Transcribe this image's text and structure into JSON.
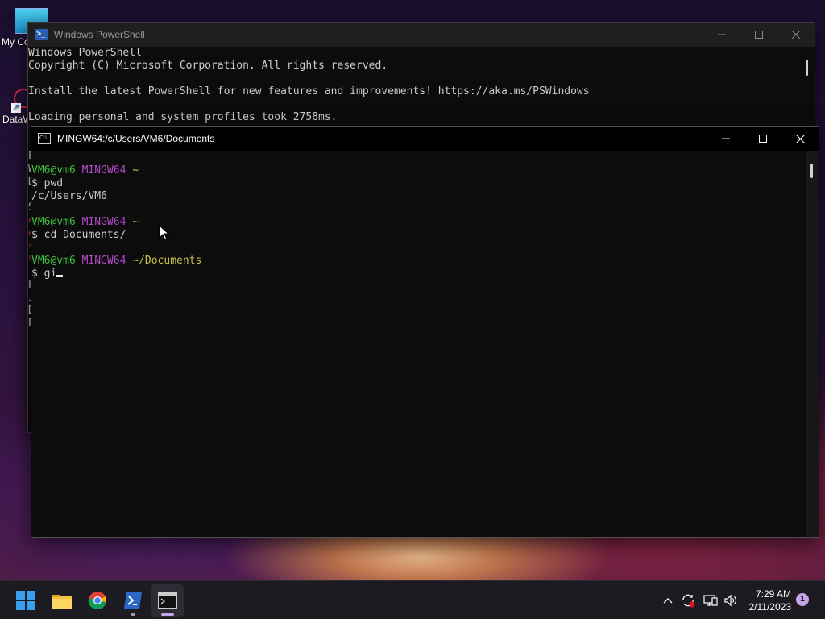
{
  "desktop": {
    "icons": [
      {
        "label": "My Co"
      },
      {
        "label": "DataW"
      }
    ]
  },
  "powershell_window": {
    "title": "Windows PowerShell",
    "lines": [
      "Windows PowerShell",
      "Copyright (C) Microsoft Corporation. All rights reserved.",
      "",
      "Install the latest PowerShell for new features and improvements! https://aka.ms/PSWindows",
      "",
      "Loading personal and system profiles took 2758ms."
    ],
    "left_edge_chars": [
      "E",
      "W",
      "D",
      "[",
      "S",
      "e",
      "e",
      "4",
      "v",
      "",
      "P",
      "I",
      "D",
      "E"
    ]
  },
  "mingw_window": {
    "title": "MINGW64:/c/Users/VM6/Documents",
    "prompt1": {
      "user": "VM6@vm6",
      "host": "MINGW64",
      "path": "~"
    },
    "cmd1": "$ pwd",
    "out1": "/c/Users/VM6",
    "prompt2": {
      "user": "VM6@vm6",
      "host": "MINGW64",
      "path": "~"
    },
    "cmd2": "$ cd Documents/",
    "prompt3": {
      "user": "VM6@vm6",
      "host": "MINGW64",
      "path": "~/Documents"
    },
    "cmd3": "$ gi"
  },
  "taskbar": {
    "apps": [
      {
        "name": "start",
        "icon": "windows-logo-icon"
      },
      {
        "name": "file-explorer",
        "icon": "folder-icon"
      },
      {
        "name": "chrome",
        "icon": "chrome-icon"
      },
      {
        "name": "powershell",
        "icon": "powershell-icon"
      },
      {
        "name": "git-bash",
        "icon": "terminal-icon"
      }
    ],
    "clock_time": "7:29 AM",
    "clock_date": "2/11/2023",
    "notification_count": "1",
    "colors": {
      "accent_indicator": "#c7a3e8",
      "taskbar_bg": "#1c1b22"
    }
  }
}
